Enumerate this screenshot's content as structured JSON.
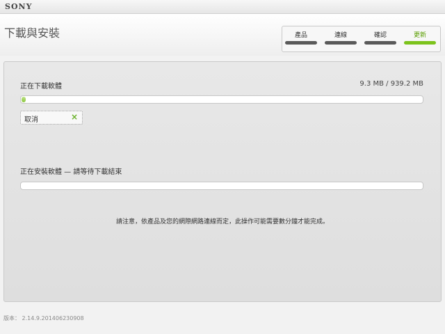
{
  "app": {
    "brand": "SONY"
  },
  "header": {
    "title": "下載與安裝",
    "steps": [
      {
        "label": "產品",
        "active": false
      },
      {
        "label": "連線",
        "active": false
      },
      {
        "label": "確認",
        "active": false
      },
      {
        "label": "更新",
        "active": true
      }
    ]
  },
  "download": {
    "label": "正在下載軟體",
    "size_text": "9.3 MB / 939.2 MB",
    "progress": 0.0099,
    "cancel_label": "取消"
  },
  "install": {
    "label": "正在安裝軟體 — 請等待下載結束",
    "progress": 0
  },
  "notice": "請注意，依產品及您的網際網路連線而定，此操作可能需要數分鐘才能完成。",
  "footer": {
    "version": "版本： 2.14.9.201406230908"
  },
  "colors": {
    "accent": "#7cc31c",
    "inactive_step": "#5a5a5a"
  }
}
